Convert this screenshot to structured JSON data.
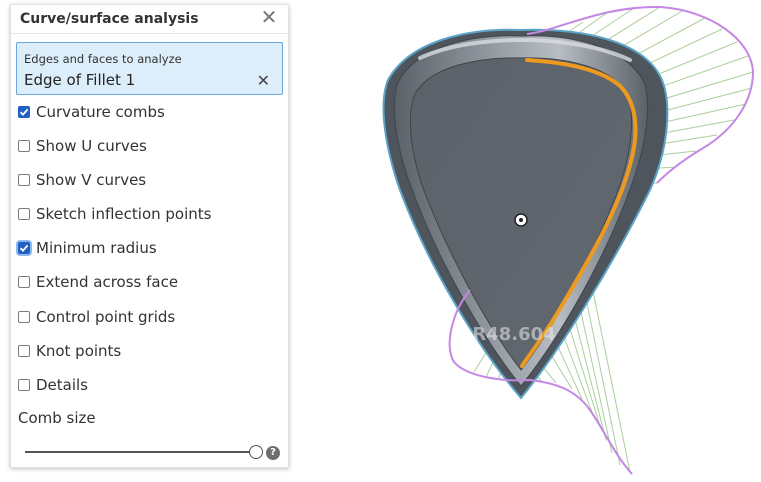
{
  "panel": {
    "title": "Curve/surface analysis",
    "close_glyph": "✕",
    "selection": {
      "label": "Edges and faces to analyze",
      "value": "Edge of Fillet 1",
      "clear_glyph": "✕"
    },
    "options": [
      {
        "label": "Curvature combs",
        "checked": true
      },
      {
        "label": "Show U curves",
        "checked": false
      },
      {
        "label": "Show V curves",
        "checked": false
      },
      {
        "label": "Sketch inflection points",
        "checked": false
      },
      {
        "label": "Minimum radius",
        "checked": true
      },
      {
        "label": "Extend across face",
        "checked": false
      },
      {
        "label": "Control point grids",
        "checked": false
      },
      {
        "label": "Knot points",
        "checked": false
      },
      {
        "label": "Details",
        "checked": false
      }
    ],
    "comb_size": {
      "label": "Comb size",
      "value": 1.0
    },
    "help_glyph": "?"
  },
  "viewport": {
    "min_radius_label": "R48.604",
    "colors": {
      "model_dark": "#4f555c",
      "model_face": "#5f656d",
      "model_rim": "#7c848c",
      "edge_outline": "#5aa4c7",
      "selected_edge": "#ee9a1e",
      "comb_envelope": "#c487e3",
      "comb_teeth": "#a9cf9c"
    }
  }
}
